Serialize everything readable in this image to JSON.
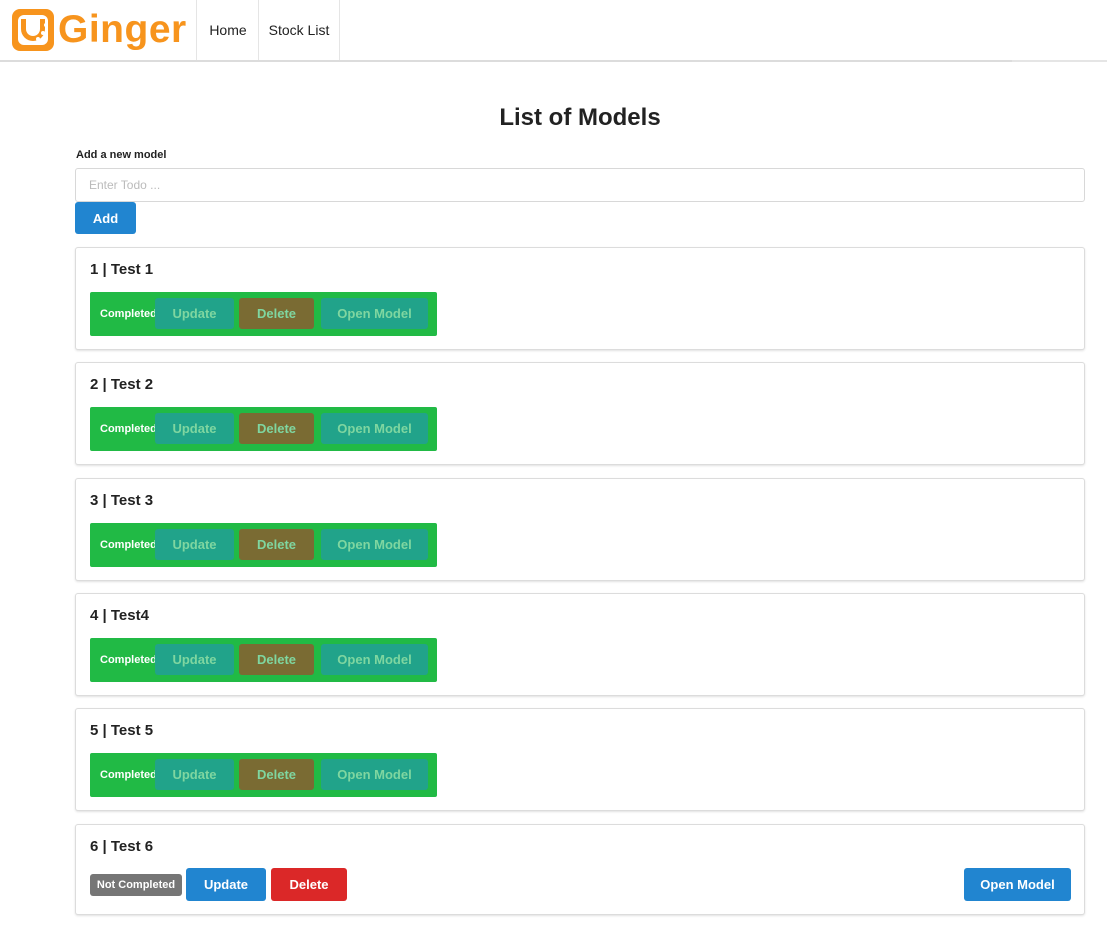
{
  "brand": {
    "name": "Ginger",
    "color": "#f7941d",
    "logo_icon": "ginger-logo-icon"
  },
  "nav": {
    "items": [
      {
        "label": "Home"
      },
      {
        "label": "Stock List"
      }
    ]
  },
  "page": {
    "title": "List of Models",
    "add_label": "Add a new model",
    "input_placeholder": "Enter Todo ...",
    "input_value": "",
    "add_button": "Add"
  },
  "models": [
    {
      "title": "1 | Test 1",
      "status": "Completed",
      "update": "Update",
      "delete": "Delete",
      "open": "Open Model"
    },
    {
      "title": "2 | Test 2",
      "status": "Completed",
      "update": "Update",
      "delete": "Delete",
      "open": "Open Model"
    },
    {
      "title": "3 | Test 3",
      "status": "Completed",
      "update": "Update",
      "delete": "Delete",
      "open": "Open Model"
    },
    {
      "title": "4 | Test4",
      "status": "Completed",
      "update": "Update",
      "delete": "Delete",
      "open": "Open Model"
    },
    {
      "title": "5 | Test 5",
      "status": "Completed",
      "update": "Update",
      "delete": "Delete",
      "open": "Open Model"
    },
    {
      "title": "6 | Test 6",
      "status": "Not Completed",
      "update": "Update",
      "delete": "Delete",
      "open": "Open Model"
    }
  ],
  "colors": {
    "primary": "#2185d0",
    "danger": "#db2828",
    "completed": "#21ba45",
    "not_completed": "#767676"
  }
}
